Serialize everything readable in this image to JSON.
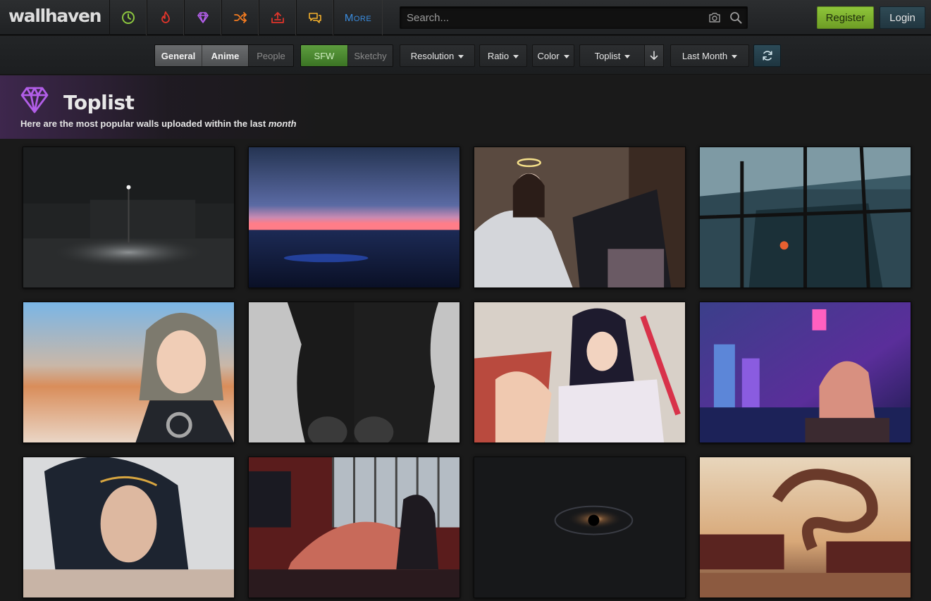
{
  "header": {
    "logo": "wallhaven",
    "nav": [
      {
        "icon": "clock-icon",
        "color": "#8cc63f"
      },
      {
        "icon": "flame-icon",
        "color": "#e0352b"
      },
      {
        "icon": "diamond-icon",
        "color": "#b25ee8"
      },
      {
        "icon": "shuffle-icon",
        "color": "#f57c20"
      },
      {
        "icon": "upload-icon",
        "color": "#e0352b"
      },
      {
        "icon": "chat-icon",
        "color": "#f3b02c"
      }
    ],
    "more_label": "More",
    "search_placeholder": "Search...",
    "register_label": "Register",
    "login_label": "Login"
  },
  "filters": {
    "categories": [
      "General",
      "Anime",
      "People"
    ],
    "purity": [
      "SFW",
      "Sketchy"
    ],
    "resolution": "Resolution",
    "ratio": "Ratio",
    "color": "Color",
    "sorting": "Toplist",
    "range": "Last Month"
  },
  "page": {
    "title": "Toplist",
    "subtitle_prefix": "Here are the most popular walls uploaded within the last",
    "subtitle_em": "month"
  },
  "colors": {
    "accent_green": "#8cc63f",
    "accent_purple": "#b25ee8",
    "more_blue": "#3a8de0"
  },
  "thumbnails": [
    {
      "id": "night-street"
    },
    {
      "id": "ocean-horizon"
    },
    {
      "id": "angel-maid"
    },
    {
      "id": "city-window"
    },
    {
      "id": "cyber-girl"
    },
    {
      "id": "black-stockings"
    },
    {
      "id": "anime-kimono"
    },
    {
      "id": "neon-city"
    },
    {
      "id": "dark-hair-portrait"
    },
    {
      "id": "red-room"
    },
    {
      "id": "black-hole"
    },
    {
      "id": "dragon-pagoda"
    }
  ]
}
